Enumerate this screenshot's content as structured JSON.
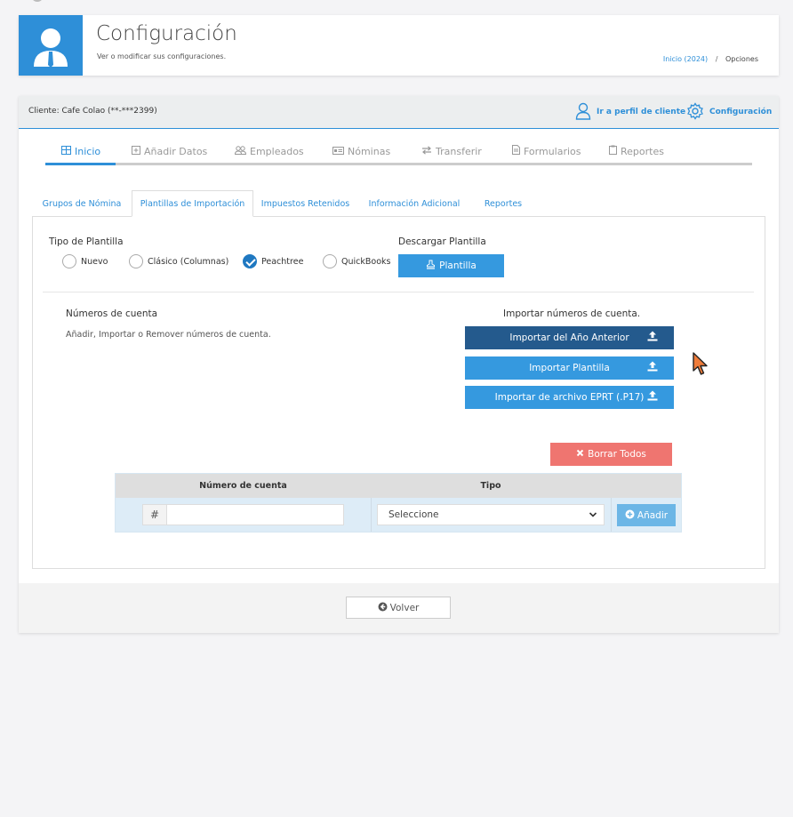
{
  "header": {
    "title": "Configuración",
    "subtitle": "Ver o modificar sus configuraciones.",
    "breadcrumb": {
      "home": "Inicio (2024)",
      "separator": "/",
      "current": "Opciones"
    }
  },
  "client_bar": {
    "client_label": "Cliente: Cafe Colao (**-***2399)",
    "profile_link": "Ir a perfil de cliente",
    "config_link": "Configuración"
  },
  "nav": {
    "items": [
      {
        "label": "Inicio",
        "icon": "table-icon"
      },
      {
        "label": "Añadir Datos",
        "icon": "plus-square-icon"
      },
      {
        "label": "Empleados",
        "icon": "users-icon"
      },
      {
        "label": "Nóminas",
        "icon": "card-icon"
      },
      {
        "label": "Transferir",
        "icon": "arrows-icon"
      },
      {
        "label": "Formularios",
        "icon": "file-icon"
      },
      {
        "label": "Reportes",
        "icon": "clipboard-icon"
      }
    ]
  },
  "subtabs": [
    "Grupos de Nómina",
    "Plantillas de Importación",
    "Impuestos Retenidos",
    "Información Adicional",
    "Reportes"
  ],
  "template": {
    "type_label": "Tipo de Plantilla",
    "options": [
      "Nuevo",
      "Clásico (Columnas)",
      "Peachtree",
      "QuickBooks"
    ],
    "selected": "Peachtree",
    "download_label": "Descargar Plantilla",
    "download_button": "Plantilla"
  },
  "accounts": {
    "title": "Números de cuenta",
    "description": "Añadir, Importar o Remover números de cuenta.",
    "import_title": "Importar números de cuenta.",
    "import_prev_year": "Importar del Año Anterior",
    "import_template": "Importar Plantilla",
    "import_eprt": "Importar de archivo EPRT (.P17)",
    "delete_all": "Borrar Todos"
  },
  "table": {
    "col_account": "Número de cuenta",
    "col_type": "Tipo",
    "hash": "#",
    "account_value": "",
    "type_selected": "Seleccione",
    "add_button": "Añadir"
  },
  "footer": {
    "back_button": "Volver"
  },
  "colors": {
    "accent": "#2e8fd8",
    "dark_button": "#245a8d",
    "light_button": "#3599df",
    "danger": "#ef7570"
  }
}
